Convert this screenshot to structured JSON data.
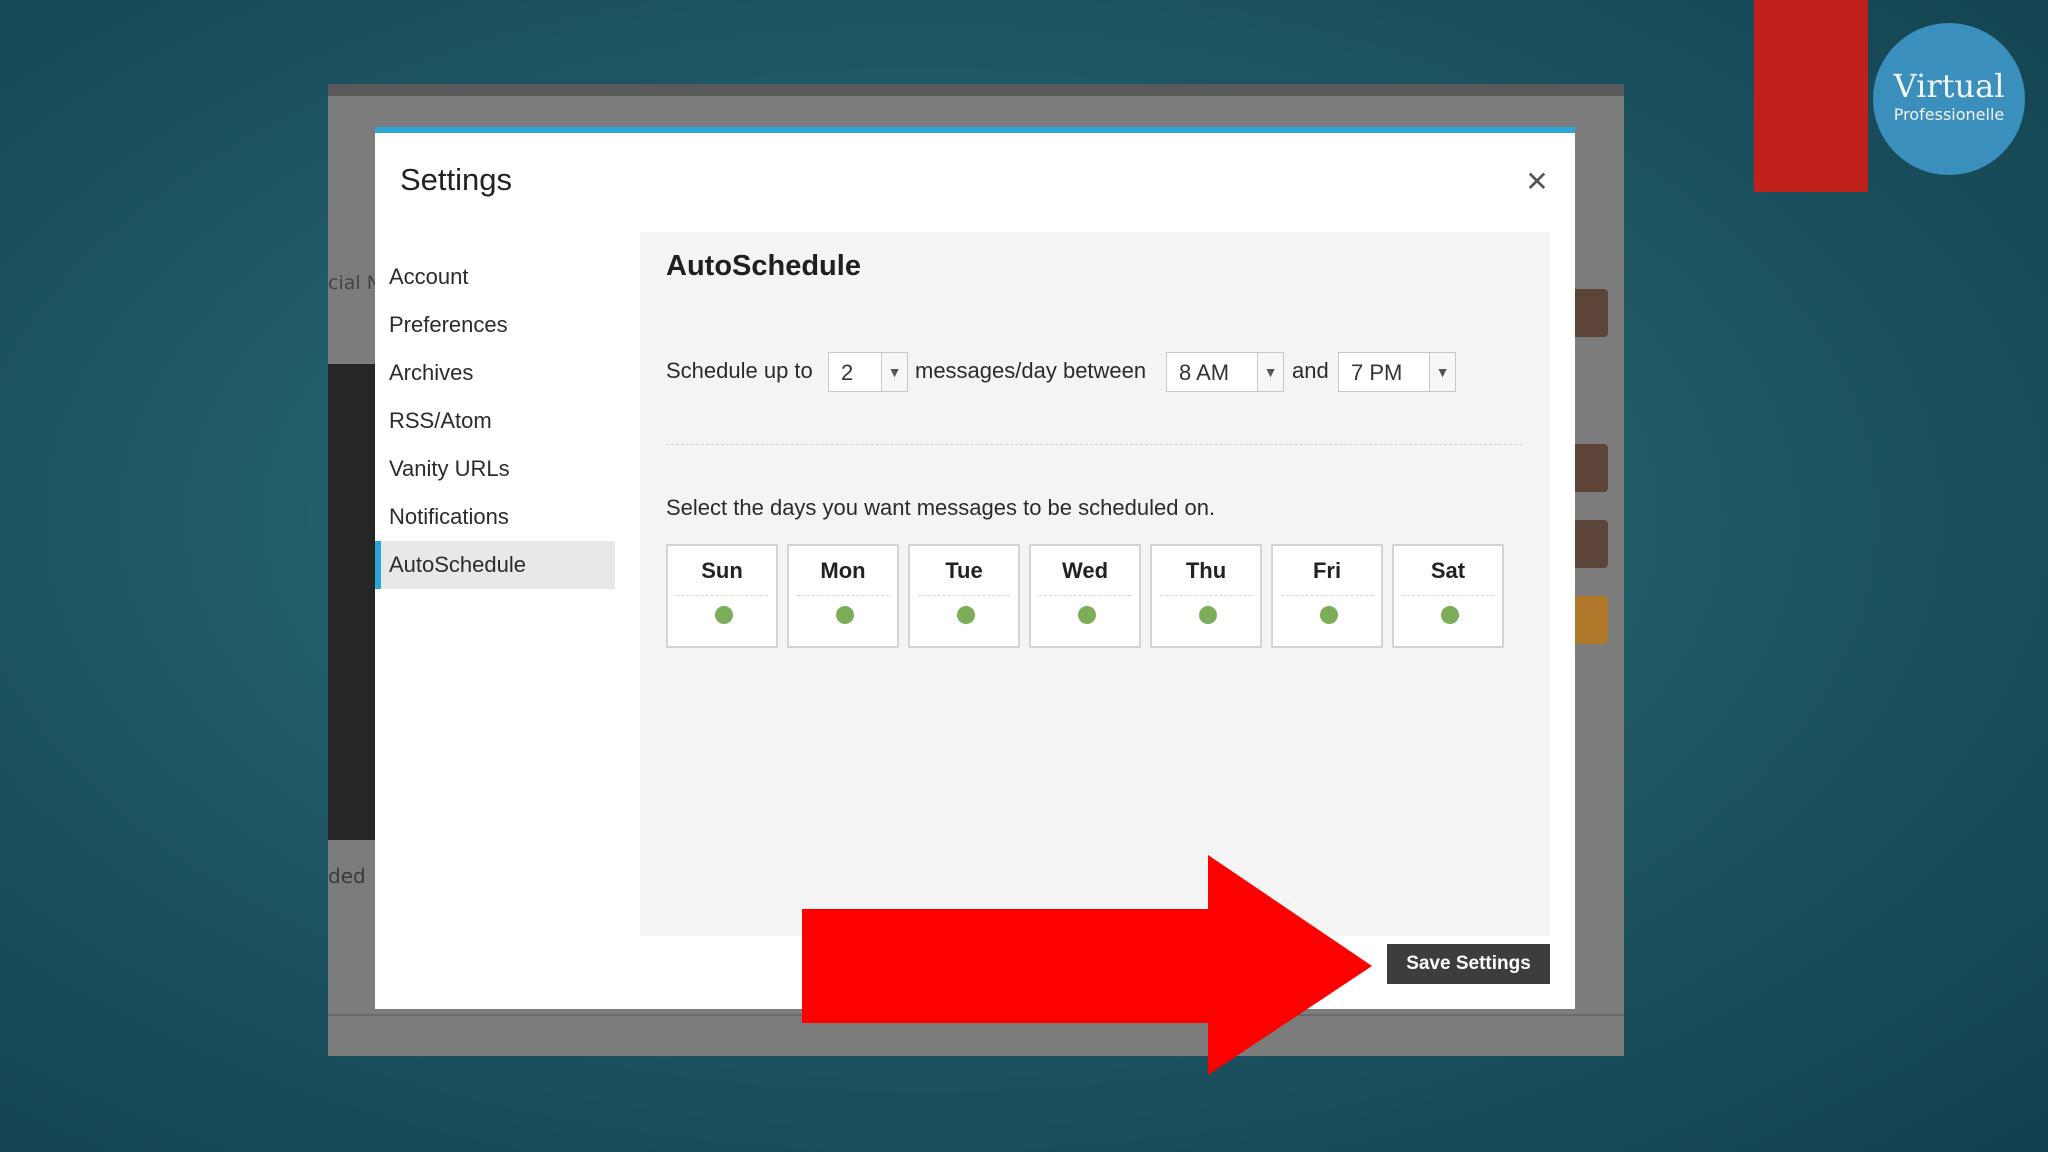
{
  "brand": {
    "title": "Virtual",
    "subtitle": "Professionelle",
    "bar_color": "#c0201c",
    "circle_color": "#3a8fbd"
  },
  "background_window": {
    "tab_fragment": "cial N",
    "side_word_fragment": "ded"
  },
  "modal": {
    "title": "Settings",
    "close_icon": "close-icon",
    "accent_color": "#2aa7d8",
    "nav": [
      {
        "label": "Account",
        "active": false
      },
      {
        "label": "Preferences",
        "active": false
      },
      {
        "label": "Archives",
        "active": false
      },
      {
        "label": "RSS/Atom",
        "active": false
      },
      {
        "label": "Vanity URLs",
        "active": false
      },
      {
        "label": "Notifications",
        "active": false
      },
      {
        "label": "AutoSchedule",
        "active": true
      }
    ],
    "autoschedule": {
      "title": "AutoSchedule",
      "schedule_prefix": "Schedule up to",
      "messages_count": "2",
      "messages_suffix": "messages/day between",
      "start_time": "8 AM",
      "and_label": "and",
      "end_time": "7 PM",
      "days_label": "Select the days you want messages to be scheduled on.",
      "days": [
        {
          "name": "Sun",
          "enabled": true
        },
        {
          "name": "Mon",
          "enabled": true
        },
        {
          "name": "Tue",
          "enabled": true
        },
        {
          "name": "Wed",
          "enabled": true
        },
        {
          "name": "Thu",
          "enabled": true
        },
        {
          "name": "Fri",
          "enabled": true
        },
        {
          "name": "Sat",
          "enabled": true
        }
      ],
      "day_dot_color": "#7cae5a"
    },
    "save_label": "Save Settings"
  },
  "annotation": {
    "arrow_color": "#ff0000",
    "icon": "arrow-right-icon"
  }
}
